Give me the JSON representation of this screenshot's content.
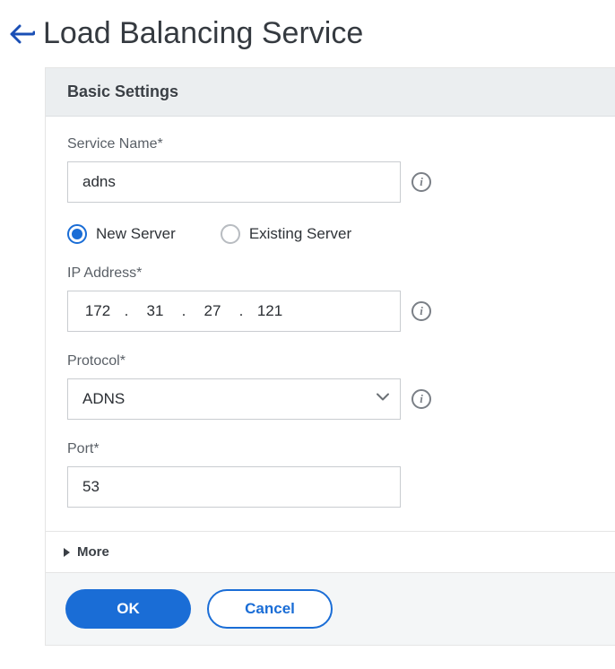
{
  "header": {
    "title": "Load Balancing Service"
  },
  "section": {
    "title": "Basic Settings"
  },
  "fields": {
    "service_name": {
      "label": "Service Name*",
      "value": "adns"
    },
    "server_mode": {
      "option_new": "New Server",
      "option_existing": "Existing Server",
      "selected": "new"
    },
    "ip_address": {
      "label": "IP Address*",
      "octet1": "172",
      "octet2": "31",
      "octet3": "27",
      "octet4": "121"
    },
    "protocol": {
      "label": "Protocol*",
      "value": "ADNS"
    },
    "port": {
      "label": "Port*",
      "value": "53"
    }
  },
  "more": {
    "label": "More"
  },
  "footer": {
    "ok": "OK",
    "cancel": "Cancel"
  }
}
